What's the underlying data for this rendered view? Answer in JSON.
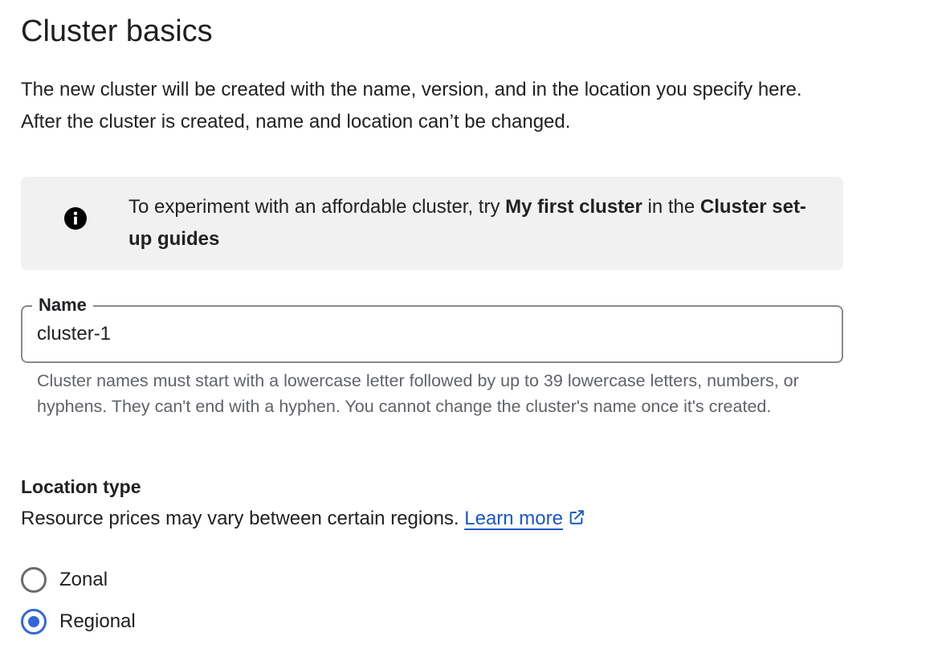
{
  "page": {
    "title": "Cluster basics",
    "intro": "The new cluster will be created with the name, version, and in the location you specify here. After the cluster is created, name and location can’t be changed."
  },
  "info_box": {
    "icon": "info-icon",
    "text_before": "To experiment with an affordable cluster, try ",
    "bold_1": "My first cluster",
    "text_middle": " in the ",
    "bold_2": "Cluster set-up guides"
  },
  "name_field": {
    "label": "Name",
    "value": "cluster-1",
    "helper": "Cluster names must start with a lowercase letter followed by up to 39 lowercase letters, numbers, or hyphens. They can't end with a hyphen. You cannot change the cluster's name once it's created."
  },
  "location_type": {
    "title": "Location type",
    "description": "Resource prices may vary between certain regions. ",
    "learn_more": "Learn more",
    "link_icon": "external-link-icon",
    "options": [
      {
        "label": "Zonal",
        "checked": false
      },
      {
        "label": "Regional",
        "checked": true
      }
    ]
  },
  "colors": {
    "accent": "#3367d6",
    "link": "#1a57c9",
    "info_bg": "#f1f1f1",
    "helper_text": "#5f6368"
  }
}
